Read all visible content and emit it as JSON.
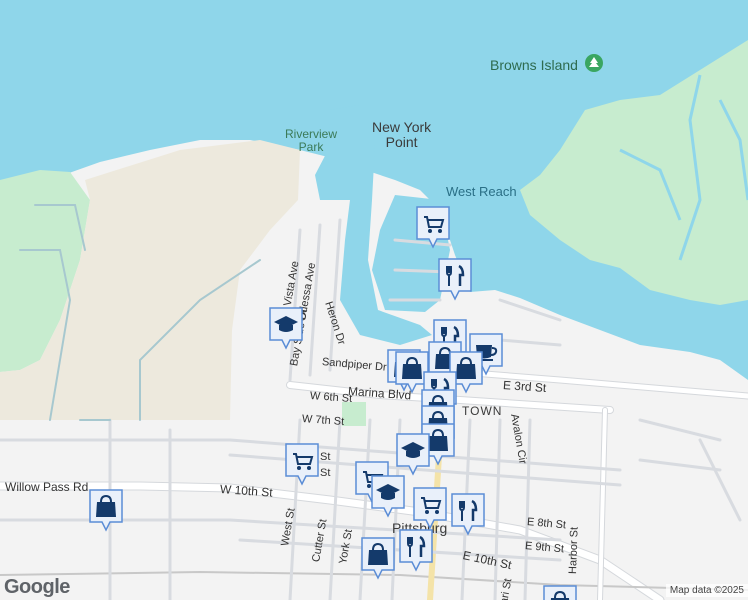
{
  "map": {
    "colors": {
      "water": "#8fd6ea",
      "land": "#f3f3f3",
      "park": "#c7eccf",
      "sand": "#ede9dd",
      "road": "#ffffff",
      "road_edge": "#d5d8dc",
      "marker_bg": "#e9f0fa",
      "marker_border": "#5b8dd6",
      "marker_icon": "#143a6b"
    },
    "water_labels": [
      {
        "id": "west-reach",
        "text": "West Reach"
      }
    ],
    "place_labels": [
      {
        "id": "new-york-point",
        "line1": "New York",
        "line2": "Point"
      },
      {
        "id": "browns-island",
        "text": "Browns Island"
      },
      {
        "id": "riverview-park",
        "line1": "Riverview",
        "line2": "Park"
      },
      {
        "id": "pittsburg",
        "text": "Pittsburg"
      },
      {
        "id": "downtown",
        "text": "TOWN"
      }
    ],
    "streets": [
      {
        "id": "willow-pass-rd",
        "text": "Willow Pass Rd"
      },
      {
        "id": "w-10th-st",
        "text": "W 10th St"
      },
      {
        "id": "marina-blvd",
        "text": "Marina Blvd"
      },
      {
        "id": "sandpiper-dr",
        "text": "Sandpiper Dr"
      },
      {
        "id": "w-6th-st",
        "text": "W 6th St"
      },
      {
        "id": "w-7th-st",
        "text": "W 7th St"
      },
      {
        "id": "e-3rd-st",
        "text": "E 3rd St"
      },
      {
        "id": "e-8th-st",
        "text": "E 8th St"
      },
      {
        "id": "e-9th-st",
        "text": "E 9th St"
      },
      {
        "id": "e-10th-st",
        "text": "E 10th St"
      },
      {
        "id": "avalon-cir",
        "text": "Avalon Cir"
      },
      {
        "id": "harbor-st",
        "text": "Harbor St"
      },
      {
        "id": "heron-dr",
        "text": "Heron Dr"
      },
      {
        "id": "bay-side-dr",
        "text": "Bay Side Dr"
      },
      {
        "id": "odessa-ave",
        "text": "Odessa Ave"
      },
      {
        "id": "buena-vista-ave",
        "text": "da Vista Ave"
      },
      {
        "id": "west-st",
        "text": "West St"
      },
      {
        "id": "cutter-st",
        "text": "Cutter St"
      },
      {
        "id": "york-st",
        "text": "York St"
      },
      {
        "id": "st-fragment-1",
        "text": "St"
      },
      {
        "id": "st-fragment-2",
        "text": "St"
      },
      {
        "id": "st-fragment-3",
        "text": "ari St"
      }
    ],
    "markers": [
      {
        "type": "shopping-cart"
      },
      {
        "type": "restaurant"
      },
      {
        "type": "school"
      },
      {
        "type": "restaurant"
      },
      {
        "type": "coffee"
      },
      {
        "type": "shopping-bag"
      },
      {
        "type": "shopping-bag"
      },
      {
        "type": "shopping-bag"
      },
      {
        "type": "shopping-bag"
      },
      {
        "type": "restaurant"
      },
      {
        "type": "shopping-bag"
      },
      {
        "type": "shopping-bag"
      },
      {
        "type": "shopping-bag"
      },
      {
        "type": "school"
      },
      {
        "type": "shopping-cart"
      },
      {
        "type": "shopping-cart"
      },
      {
        "type": "school"
      },
      {
        "type": "shopping-cart"
      },
      {
        "type": "restaurant"
      },
      {
        "type": "shopping-bag"
      },
      {
        "type": "restaurant"
      },
      {
        "type": "shopping-bag"
      },
      {
        "type": "shopping-bag"
      }
    ],
    "attribution": {
      "logo": "Google",
      "data": "Map data ©2025"
    }
  }
}
